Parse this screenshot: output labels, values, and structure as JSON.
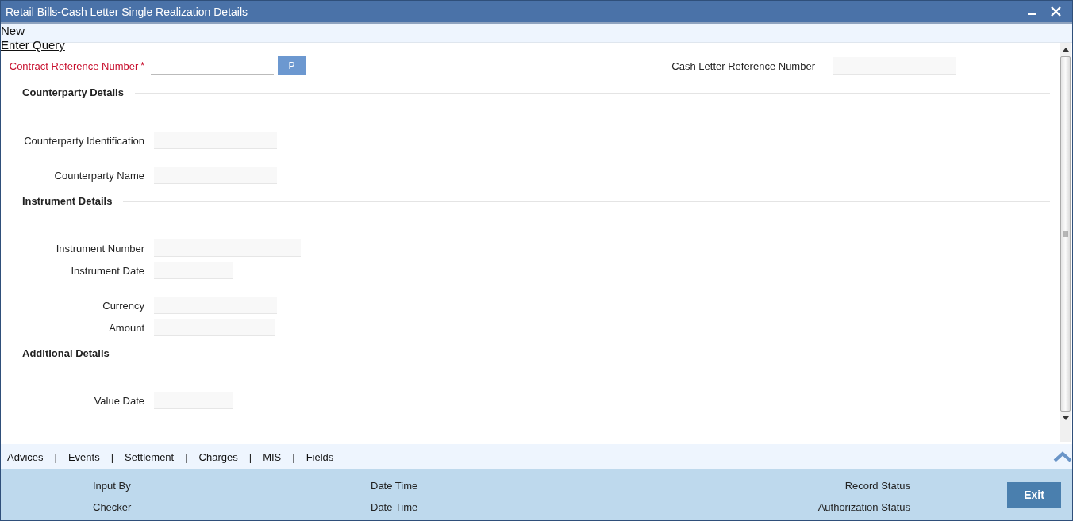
{
  "window": {
    "title": "Retail Bills-Cash Letter Single Realization Details"
  },
  "menu": [
    "New",
    "Enter Query"
  ],
  "header": {
    "contract_reference": {
      "label": "Contract Reference Number",
      "required_mark": "*",
      "button": "P"
    },
    "cash_letter_reference": {
      "label": "Cash Letter Reference Number"
    }
  },
  "sections": [
    {
      "title": "Counterparty Details",
      "fields": [
        {
          "label": "Counterparty Identification"
        },
        {
          "label": "Counterparty Name"
        }
      ]
    },
    {
      "title": "Instrument Details",
      "fields": [
        {
          "label": "Instrument Number"
        },
        {
          "label": "Instrument Date"
        },
        {
          "label": "Currency"
        },
        {
          "label": "Amount"
        }
      ]
    },
    {
      "title": "Additional Details",
      "fields": [
        {
          "label": "Value Date"
        }
      ]
    }
  ],
  "tabs": [
    {
      "kind": "tab",
      "text": "Advices"
    },
    {
      "kind": "separator",
      "text": "|"
    },
    {
      "kind": "tab",
      "text": "Events"
    },
    {
      "kind": "separator",
      "text": "|"
    },
    {
      "kind": "tab",
      "text": "Settlement"
    },
    {
      "kind": "separator",
      "text": "|"
    },
    {
      "kind": "tab",
      "text": "Charges"
    },
    {
      "kind": "separator",
      "text": "|"
    },
    {
      "kind": "tab",
      "text": "MIS"
    },
    {
      "kind": "separator",
      "text": "|"
    },
    {
      "kind": "tab",
      "text": "Fields"
    }
  ],
  "footer": {
    "labels": [
      "Input By",
      "Date Time",
      "Record Status",
      "Checker",
      "Date Time",
      "Authorization Status"
    ],
    "button": "Exit"
  }
}
